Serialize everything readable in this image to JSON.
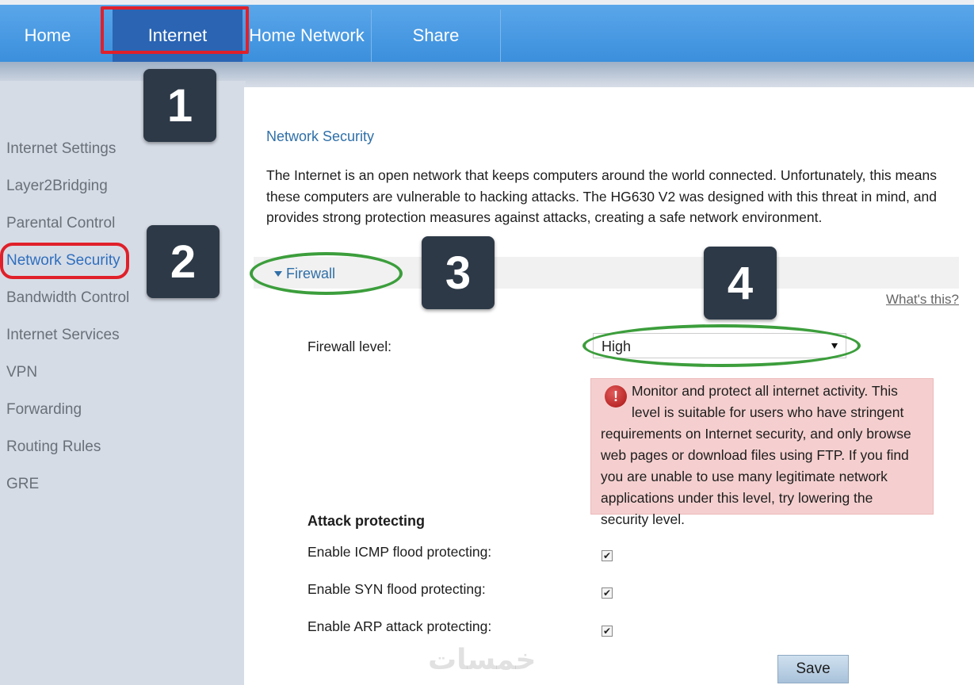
{
  "nav": {
    "items": [
      {
        "label": "Home"
      },
      {
        "label": "Internet"
      },
      {
        "label": "Home Network"
      },
      {
        "label": "Share"
      }
    ],
    "active": "Internet"
  },
  "sidebar": {
    "items": [
      {
        "label": "Internet Settings"
      },
      {
        "label": "Layer2Bridging"
      },
      {
        "label": "Parental Control"
      },
      {
        "label": "Network Security"
      },
      {
        "label": "Bandwidth Control"
      },
      {
        "label": "Internet Services"
      },
      {
        "label": "VPN"
      },
      {
        "label": "Forwarding"
      },
      {
        "label": "Routing Rules"
      },
      {
        "label": "GRE"
      }
    ],
    "active": "Network Security"
  },
  "main": {
    "title": "Network Security",
    "intro": "The Internet is an open network that keeps computers around the world connected. Unfortunately, this means these computers are vulnerable to hacking attacks. The HG630 V2 was designed with this threat in mind, and provides strong protection measures against attacks, creating a safe network environment.",
    "firewall_section": "Firewall",
    "whats_this": "What's this?",
    "firewall_level_label": "Firewall level:",
    "firewall_level_value": "High",
    "warning_text": "Monitor and protect all internet activity. This level is suitable for users who have stringent requirements on Internet security, and only browse web pages or download files using FTP. If you find you are unable to use many legitimate network applications under this level, try lowering the security level.",
    "attack_title": "Attack protecting",
    "protections": [
      {
        "label": "Enable ICMP flood protecting:",
        "checked": true
      },
      {
        "label": "Enable SYN flood protecting:",
        "checked": true
      },
      {
        "label": "Enable ARP attack protecting:",
        "checked": true
      }
    ],
    "save_label": "Save"
  },
  "annotations": {
    "steps": [
      "1",
      "2",
      "3",
      "4"
    ]
  },
  "watermark": "خمسات",
  "colors": {
    "nav_blue": "#3b8fdc",
    "nav_active": "#2a64b3",
    "link_blue": "#2f6fa8",
    "highlight_red": "#e0202a",
    "highlight_green": "#3c9e3c",
    "warning_bg": "#f5cfcf",
    "badge_bg": "#2d3947"
  }
}
